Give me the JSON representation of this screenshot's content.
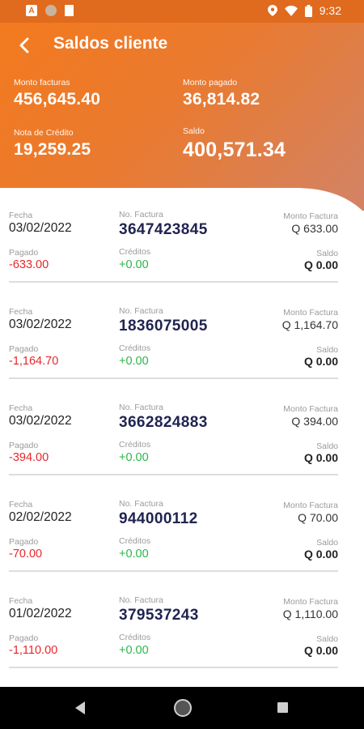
{
  "status_bar": {
    "time": "9:32",
    "left_icons": [
      "a-icon",
      "circle-icon",
      "sim-card-icon"
    ],
    "right_icons": [
      "location-icon",
      "wifi-icon",
      "battery-icon"
    ]
  },
  "header": {
    "title": "Saldos cliente",
    "stats": [
      {
        "label": "Monto facturas",
        "value": "456,645.40"
      },
      {
        "label": "Monto pagado",
        "value": "36,814.82"
      },
      {
        "label": "Nota de Crédito",
        "value": "19,259.25"
      },
      {
        "label": "Saldo",
        "value": "400,571.34"
      }
    ]
  },
  "labels": {
    "fecha": "Fecha",
    "factura": "No. Factura",
    "monto": "Monto Factura",
    "pagado": "Pagado",
    "creditos": "Créditos",
    "saldo": "Saldo"
  },
  "invoices": [
    {
      "fecha": "03/02/2022",
      "factura": "3647423845",
      "monto": "Q 633.00",
      "pagado": "-633.00",
      "creditos": "+0.00",
      "saldo": "Q 0.00"
    },
    {
      "fecha": "03/02/2022",
      "factura": "1836075005",
      "monto": "Q 1,164.70",
      "pagado": "-1,164.70",
      "creditos": "+0.00",
      "saldo": "Q 0.00"
    },
    {
      "fecha": "03/02/2022",
      "factura": "3662824883",
      "monto": "Q 394.00",
      "pagado": "-394.00",
      "creditos": "+0.00",
      "saldo": "Q 0.00"
    },
    {
      "fecha": "02/02/2022",
      "factura": "944000112",
      "monto": "Q 70.00",
      "pagado": "-70.00",
      "creditos": "+0.00",
      "saldo": "Q 0.00"
    },
    {
      "fecha": "01/02/2022",
      "factura": "379537243",
      "monto": "Q 1,110.00",
      "pagado": "-1,110.00",
      "creditos": "+0.00",
      "saldo": "Q 0.00"
    }
  ],
  "colors": {
    "accent": "#f37a1f",
    "paid": "#e8262b",
    "credit": "#2bb64a",
    "invoice": "#1f2450"
  }
}
